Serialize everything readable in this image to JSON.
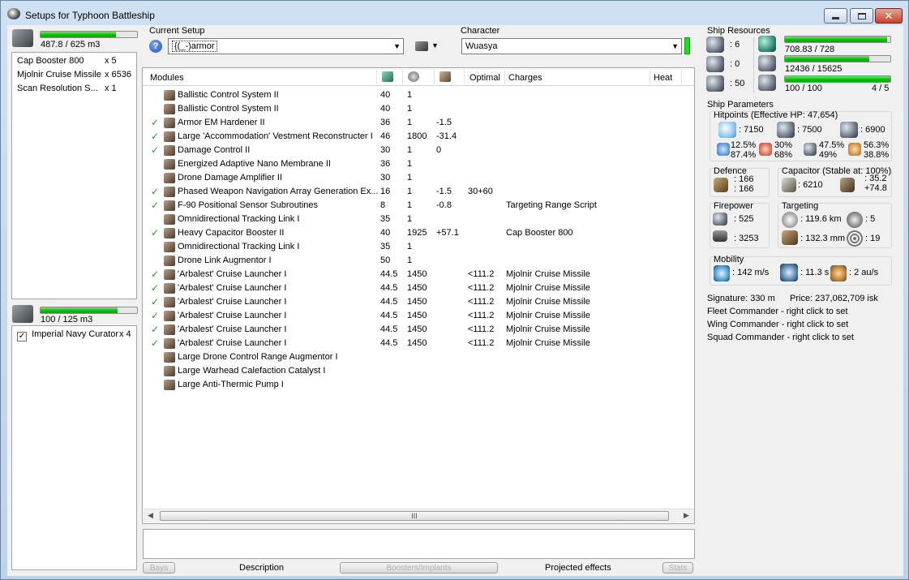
{
  "window": {
    "title": "Setups for Typhoon Battleship"
  },
  "cargo": {
    "capacity": "487.8 / 625 m3",
    "fill_fraction": 0.78,
    "items": [
      {
        "name": "Cap Booster 800",
        "qty": "x 5"
      },
      {
        "name": "Mjolnir Cruise Missile",
        "qty": "x 6536"
      },
      {
        "name": "Scan Resolution S...",
        "qty": "x 1"
      }
    ]
  },
  "drones": {
    "capacity": "100 / 125 m3",
    "fill_fraction": 0.8,
    "items": [
      {
        "name": "Imperial Navy Curator",
        "qty": "x 4",
        "checked": true
      }
    ]
  },
  "setup": {
    "label": "Current Setup",
    "value": "{(_-)armor",
    "help_glyph": "?"
  },
  "character": {
    "label": "Character",
    "value": "Wuasya"
  },
  "modules": {
    "headers": {
      "name": "Modules",
      "optimal": "Optimal",
      "charges": "Charges",
      "heat": "Heat"
    },
    "rows": [
      {
        "check": false,
        "name": "Ballistic Control System II",
        "cpu": "40",
        "pg": "1",
        "cap": "",
        "optimal": "",
        "charge": ""
      },
      {
        "check": false,
        "name": "Ballistic Control System II",
        "cpu": "40",
        "pg": "1",
        "cap": "",
        "optimal": "",
        "charge": ""
      },
      {
        "check": true,
        "name": "Armor EM Hardener II",
        "cpu": "36",
        "pg": "1",
        "cap": "-1.5",
        "optimal": "",
        "charge": ""
      },
      {
        "check": true,
        "name": "Large 'Accommodation' Vestment Reconstructer I",
        "cpu": "46",
        "pg": "1800",
        "cap": "-31.4",
        "optimal": "",
        "charge": ""
      },
      {
        "check": true,
        "name": "Damage Control II",
        "cpu": "30",
        "pg": "1",
        "cap": "0",
        "optimal": "",
        "charge": ""
      },
      {
        "check": false,
        "name": "Energized Adaptive Nano Membrane II",
        "cpu": "36",
        "pg": "1",
        "cap": "",
        "optimal": "",
        "charge": ""
      },
      {
        "check": false,
        "name": "Drone Damage Amplifier II",
        "cpu": "30",
        "pg": "1",
        "cap": "",
        "optimal": "",
        "charge": ""
      },
      {
        "check": true,
        "name": "Phased Weapon Navigation Array Generation Ex...",
        "cpu": "16",
        "pg": "1",
        "cap": "-1.5",
        "optimal": "30+60",
        "charge": ""
      },
      {
        "check": true,
        "name": "F-90 Positional Sensor Subroutines",
        "cpu": "8",
        "pg": "1",
        "cap": "-0.8",
        "optimal": "",
        "charge": "Targeting Range Script"
      },
      {
        "check": false,
        "name": "Omnidirectional Tracking Link I",
        "cpu": "35",
        "pg": "1",
        "cap": "",
        "optimal": "",
        "charge": ""
      },
      {
        "check": true,
        "name": "Heavy Capacitor Booster II",
        "cpu": "40",
        "pg": "1925",
        "cap": "+57.1",
        "optimal": "",
        "charge": "Cap Booster 800"
      },
      {
        "check": false,
        "name": "Omnidirectional Tracking Link I",
        "cpu": "35",
        "pg": "1",
        "cap": "",
        "optimal": "",
        "charge": ""
      },
      {
        "check": false,
        "name": "Drone Link Augmentor I",
        "cpu": "50",
        "pg": "1",
        "cap": "",
        "optimal": "",
        "charge": ""
      },
      {
        "check": true,
        "name": "'Arbalest' Cruise Launcher I",
        "cpu": "44.5",
        "pg": "1450",
        "cap": "",
        "optimal": "<111.2",
        "charge": "Mjolnir Cruise Missile"
      },
      {
        "check": true,
        "name": "'Arbalest' Cruise Launcher I",
        "cpu": "44.5",
        "pg": "1450",
        "cap": "",
        "optimal": "<111.2",
        "charge": "Mjolnir Cruise Missile"
      },
      {
        "check": true,
        "name": "'Arbalest' Cruise Launcher I",
        "cpu": "44.5",
        "pg": "1450",
        "cap": "",
        "optimal": "<111.2",
        "charge": "Mjolnir Cruise Missile"
      },
      {
        "check": true,
        "name": "'Arbalest' Cruise Launcher I",
        "cpu": "44.5",
        "pg": "1450",
        "cap": "",
        "optimal": "<111.2",
        "charge": "Mjolnir Cruise Missile"
      },
      {
        "check": true,
        "name": "'Arbalest' Cruise Launcher I",
        "cpu": "44.5",
        "pg": "1450",
        "cap": "",
        "optimal": "<111.2",
        "charge": "Mjolnir Cruise Missile"
      },
      {
        "check": true,
        "name": "'Arbalest' Cruise Launcher I",
        "cpu": "44.5",
        "pg": "1450",
        "cap": "",
        "optimal": "<111.2",
        "charge": "Mjolnir Cruise Missile"
      },
      {
        "check": false,
        "name": "Large Drone Control Range Augmentor I",
        "cpu": "",
        "pg": "",
        "cap": "",
        "optimal": "",
        "charge": ""
      },
      {
        "check": false,
        "name": "Large Warhead Calefaction Catalyst I",
        "cpu": "",
        "pg": "",
        "cap": "",
        "optimal": "",
        "charge": ""
      },
      {
        "check": false,
        "name": "Large Anti-Thermic Pump I",
        "cpu": "",
        "pg": "",
        "cap": "",
        "optimal": "",
        "charge": ""
      }
    ],
    "scroll_thumb": "III"
  },
  "bottom_tabs": {
    "bays": "Bays",
    "description": "Description",
    "boosters": "Boosters/Implants",
    "projected": "Projected effects",
    "stats": "Stats"
  },
  "ship_resources": {
    "title": "Ship Resources",
    "hi_slots": ": 6",
    "med_slots": ": 0",
    "turrets": ": 50",
    "cpu": "708.83 / 728",
    "cpu_fraction": 0.97,
    "powergrid": "12436 / 15625",
    "powergrid_fraction": 0.8,
    "calibration": "100 / 100",
    "calibration_fraction": 1.0,
    "rigs": "4 / 5"
  },
  "ship_params": {
    "title": "Ship Parameters",
    "hitpoints_title": "Hitpoints (Effective HP: 47,654)",
    "shield_hp": ": 7150",
    "armor_hp": ": 7500",
    "hull_hp": ": 6900",
    "resist_1a": "12.5%",
    "resist_1b": "87.4%",
    "resist_2a": "30%",
    "resist_2b": "68%",
    "resist_3a": "47.5%",
    "resist_3b": "49%",
    "resist_4a": "56.3%",
    "resist_4b": "38.8%",
    "defence_title": "Defence",
    "defence_1": ": 166",
    "defence_2": ": 166",
    "capacitor_title": "Capacitor (Stable at: 100%)",
    "capacitor_value": ": 6210",
    "cap_a": ": 35.2",
    "cap_b": "+74.8",
    "firepower_title": "Firepower",
    "firepower_1": ": 525",
    "firepower_2": ": 3253",
    "targeting_title": "Targeting",
    "target_range": ": 119.6 km",
    "max_targets": ": 5",
    "scan_res": ": 132.3 mm",
    "sensor_str": ": 19",
    "mobility_title": "Mobility",
    "speed": ": 142 m/s",
    "align": ": 11.3 s",
    "warp": ": 2 au/s",
    "signature": "Signature: 330 m",
    "price": "Price: 237,062,709 isk",
    "fleet_cmd": "Fleet Commander - right click to set",
    "wing_cmd": "Wing Commander - right click to set",
    "squad_cmd": "Squad Commander - right click to set"
  }
}
